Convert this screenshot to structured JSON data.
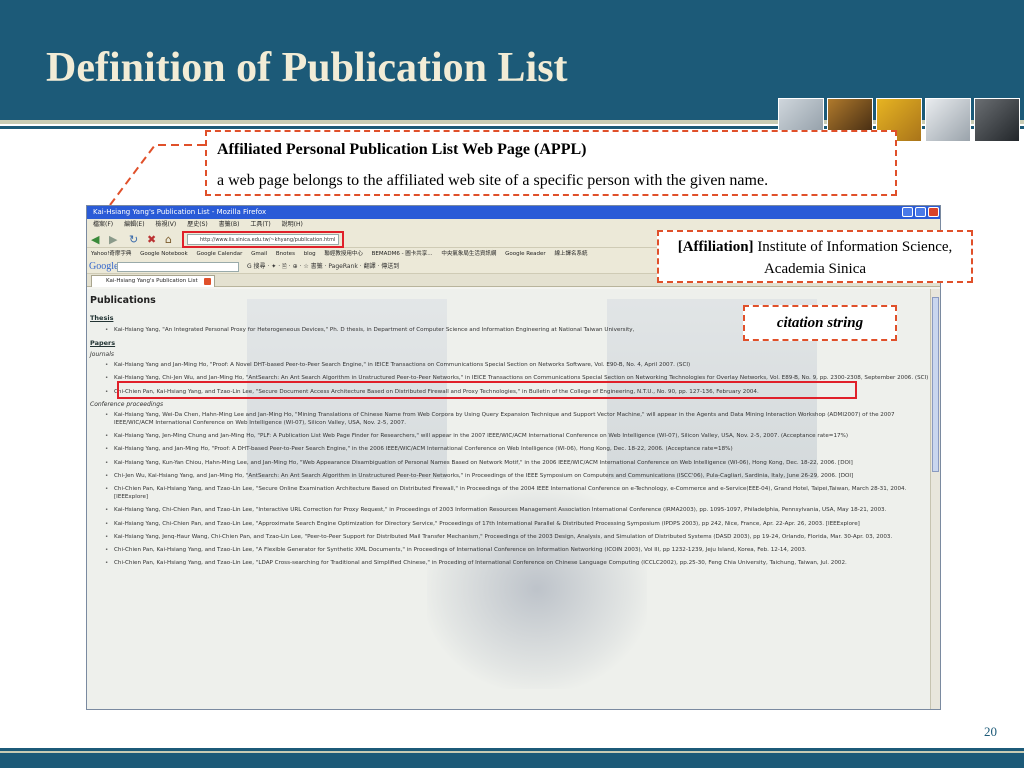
{
  "slide": {
    "title": "Definition of Publication List",
    "page_number": "20"
  },
  "appl": {
    "title": "Affiliated Personal Publication List Web Page (APPL)",
    "description": "a web page belongs to the affiliated web site of a specific person with the given name."
  },
  "affiliation": {
    "label": "[Affiliation]",
    "text": "Institute of Information Science, Academia Sinica"
  },
  "citation_label": "citation string",
  "browser": {
    "window_title": "Kai-Hsiang Yang's Publication List - Mozilla Firefox",
    "menu": [
      "檔案(F)",
      "編輯(E)",
      "檢視(V)",
      "歷史(S)",
      "書籤(B)",
      "工具(T)",
      "說明(H)"
    ],
    "url": "http://www.iis.sinica.edu.tw/~khyang/publication.html",
    "bookmarks": [
      "Yahoo!奇摩字典",
      "Google Notebook",
      "Google Calendar",
      "Gmail",
      "Bnotes",
      "blog",
      "聯經教授用中心",
      "BEMADM6 - 圖卡共享...",
      "中央氣象局生活資訊網",
      "Google Reader",
      "線上譯名系統"
    ],
    "google_label": "Google",
    "google_tools": "G 搜尋 · ✦ · 🖹 · ⊕ · ☆ 書籤 · PageRank · 翻譯 · 傳送到",
    "tab_label": "Kai-Hsiang Yang's Publication List",
    "content": {
      "heading": "Publications",
      "thesis_heading": "Thesis",
      "thesis": "Kai-Hsiang Yang, \"An Integrated Personal Proxy for Heterogeneous Devices,\" Ph. D thesis, in Department of Computer Science and Information Engineering at National Taiwan University,",
      "papers_heading": "Papers",
      "journals_heading": "Journals",
      "journals": [
        "Kai-Hsiang Yang and Jan-Ming Ho, \"Proof: A Novel DHT-based Peer-to-Peer Search Engine,\" in IEICE Transactions on Communications Special Section on Networks Software, Vol. E90-B, No. 4, April 2007. (SCI)",
        "Kai-Hsiang Yang, Chi-Jen Wu, and Jan-Ming Ho, \"AntSearch: An Ant Search Algorithm in Unstructured Peer-to-Peer Networks,\" in IEICE Transactions on Communications Special Section on Networking Technologies for Overlay Networks, Vol. E89-B, No. 9, pp. 2300-2308, September 2006. (SCI)",
        "Chi-Chien Pan, Kai-Hsiang Yang, and Tzao-Lin Lee, \"Secure Document Access Architecture Based on Distributed Firewall and Proxy Technologies,\" in Bulletin of the College of Engineering, N.T.U., No. 90, pp. 127-136, February 2004."
      ],
      "conf_heading": "Conference proceedings",
      "conferences": [
        "Kai-Hsiang Yang, Wei-Da Chen, Hahn-Ming Lee and Jan-Ming Ho, \"Mining Translations of Chinese Name from Web Corpora by Using Query Expansion Technique and Support Vector Machine,\" will appear in the Agents and Data Mining Interaction Workshop (ADMI2007) of the 2007 IEEE/WIC/ACM International Conference on Web Intelligence (WI-07), Silicon Valley, USA, Nov. 2-5, 2007.",
        "Kai-Hsiang Yang, Jen-Ming Chung and Jan-Ming Ho, \"PLF: A Publication List Web Page Finder for Researchers,\" will appear in the 2007 IEEE/WIC/ACM International Conference on Web Intelligence (WI-07), Silicon Valley, USA, Nov. 2-5, 2007. (Acceptance rate=17%)",
        "Kai-Hsiang Yang, and Jan-Ming Ho, \"Proof: A DHT-based Peer-to-Peer Search Engine,\" in the 2006 IEEE/WIC/ACM International Conference on Web Intelligence (WI-06), Hong Kong, Dec. 18-22, 2006. (Acceptance rate=18%)",
        "Kai-Hsiang Yang, Kun-Yan Chiou, Hahn-Ming Lee, and Jan-Ming Ho, \"Web Appearance Disambiguation of Personal Names Based on Network Motif,\" in the 2006 IEEE/WIC/ACM International Conference on Web Intelligence (WI-06), Hong Kong, Dec. 18-22, 2006. [DOI]",
        "Chi-Jen Wu, Kai-Hsiang Yang, and Jan-Ming Ho, \"AntSearch: An Ant Search Algorithm in Unstructured Peer-to-Peer Networks,\" in Proceedings of the IEEE Symposium on Computers and Communications (ISCC'06), Pula-Cagliari, Sardinia, Italy, June 26-29, 2006. [DOI]",
        "Chi-Chien Pan, Kai-Hsiang Yang, and Tzao-Lin Lee, \"Secure Online Examination Architecture Based on Distributed Firewall,\" in Proceedings of the 2004 IEEE International Conference on e-Technology, e-Commerce and e-Service(EEE-04), Grand Hotel, Taipei,Taiwan, March 28-31, 2004. [IEEExplore]",
        "Kai-Hsiang Yang, Chi-Chien Pan, and Tzao-Lin Lee, \"Interactive URL Correction for Proxy Request,\" in Proceedings of 2003 Information Resources Management Association International Conference (IRMA2003), pp. 1095-1097, Philadelphia, Pennsylvania, USA, May 18-21, 2003.",
        "Kai-Hsiang Yang, Chi-Chien Pan, and Tzao-Lin Lee, \"Approximate Search Engine Optimization for Directory Service,\" Proceedings of 17th International Parallel & Distributed Processing Symposium (IPDPS 2003), pp 242, Nice, France, Apr. 22-Apr. 26, 2003. [IEEExplore]",
        "Kai-Hsiang Yang, Jenq-Haur Wang, Chi-Chien Pan, and Tzao-Lin Lee, \"Peer-to-Peer Support for Distributed Mail Transfer Mechanism,\" Proceedings of the 2003 Design, Analysis, and Simulation of Distributed Systems (DASD 2003), pp 19-24, Orlando, Florida, Mar. 30-Apr. 03, 2003.",
        "Chi-Chien Pan, Kai-Hsiang Yang, and Tzao-Lin Lee, \"A Flexible Generator for Synthetic XML Documents,\" in Proceedings of International Conference on Information Networking (ICOIN 2003), Vol III, pp 1232-1239, Jeju Island, Korea, Feb. 12-14, 2003.",
        "Chi-Chien Pan, Kai-Hsiang Yang, and Tzao-Lin Lee, \"LDAP Cross-searching for Traditional and Simplified Chinese,\" in Proceding of International Conference on Chinese Language Computing (ICCLC2002), pp.25-30, Feng Chia University, Taichung, Taiwan, Jul. 2002."
      ]
    }
  }
}
